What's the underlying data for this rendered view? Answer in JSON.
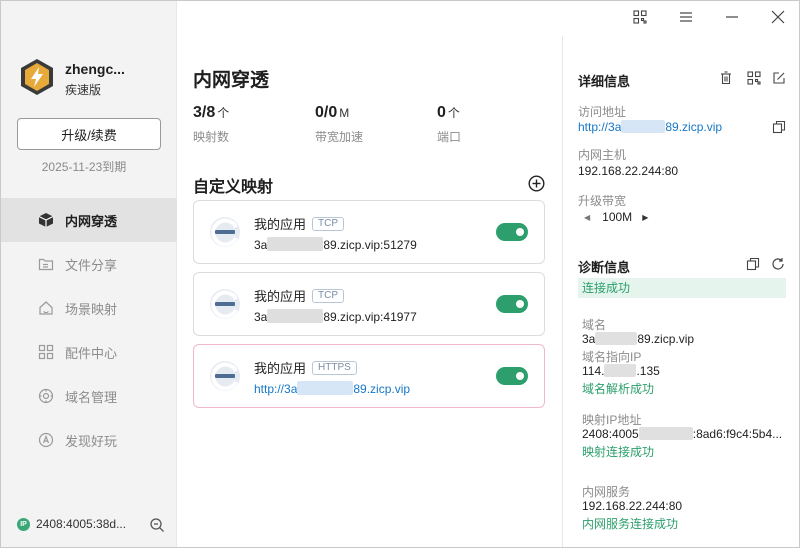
{
  "user": {
    "name": "zhengc...",
    "plan": "疾速版"
  },
  "sidebar": {
    "upgrade_label": "升级/续费",
    "expire": "2025-11-23到期",
    "items": [
      {
        "label": "内网穿透",
        "icon": "cube-icon"
      },
      {
        "label": "文件分享",
        "icon": "folder-share-icon"
      },
      {
        "label": "场景映射",
        "icon": "home-icon"
      },
      {
        "label": "配件中心",
        "icon": "grid-icon"
      },
      {
        "label": "域名管理",
        "icon": "globe-gear-icon"
      },
      {
        "label": "发现好玩",
        "icon": "compass-icon"
      }
    ],
    "ip_badge": "IP",
    "ip": "2408:4005:38d..."
  },
  "main": {
    "title": "内网穿透",
    "stats": [
      {
        "value": "3/8",
        "unit": "个",
        "label": "映射数"
      },
      {
        "value": "0/0",
        "unit": "M",
        "label": "带宽加速"
      },
      {
        "value": "0",
        "unit": "个",
        "label": "端口"
      }
    ],
    "section_title": "自定义映射",
    "mappings": [
      {
        "name": "我的应用",
        "proto": "TCP",
        "addr_prefix": "3a",
        "addr_suffix": "89.zicp.vip:51279"
      },
      {
        "name": "我的应用",
        "proto": "TCP",
        "addr_prefix": "3a",
        "addr_suffix": "89.zicp.vip:41977"
      },
      {
        "name": "我的应用",
        "proto": "HTTPS",
        "addr_prefix": "http://3a",
        "addr_suffix": "89.zicp.vip"
      }
    ]
  },
  "detail": {
    "title": "详细信息",
    "visit_label": "访问地址",
    "visit_prefix": "http://3a",
    "visit_suffix": "89.zicp.vip",
    "host_label": "内网主机",
    "host": "192.168.22.244:80",
    "bw_label": "升级带宽",
    "bw": "100M"
  },
  "diag": {
    "title": "诊断信息",
    "status": "连接成功",
    "domain_label": "域名",
    "domain_prefix": "3a",
    "domain_suffix": "89.zicp.vip",
    "domain_ip_label": "域名指向IP",
    "domain_ip_prefix": "114.",
    "domain_ip_suffix": ".135",
    "domain_ok": "域名解析成功",
    "map_ip_label": "映射IP地址",
    "map_ip_prefix": "2408:4005",
    "map_ip_suffix": ":8ad6:f9c4:5b4...",
    "map_ok": "映射连接成功",
    "svc_label": "内网服务",
    "svc": "192.168.22.244:80",
    "svc_ok": "内网服务连接成功"
  },
  "colors": {
    "accent_green": "#2c9f6c",
    "link_blue": "#1677c9"
  }
}
